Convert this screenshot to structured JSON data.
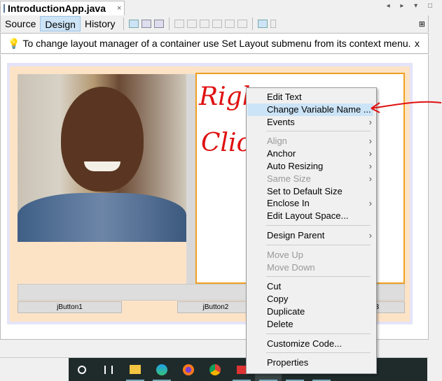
{
  "file_tab": {
    "title": "IntroductionApp.java",
    "close": "×"
  },
  "window_controls": "◂ ▸ ▾ □",
  "view_tabs": [
    {
      "label": "Source"
    },
    {
      "label": "Design",
      "selected": true
    },
    {
      "label": "History"
    }
  ],
  "hint": {
    "text": "To change layout manager of a container use Set Layout submenu from its context menu.",
    "close": "x",
    "icon": "lightbulb-icon"
  },
  "annotation": {
    "line1": "Right",
    "line2": "Click",
    "color": "#e01010"
  },
  "buttons": [
    "jButton1",
    "jButton2",
    "3"
  ],
  "context_menu": {
    "items": [
      {
        "label": "Edit Text"
      },
      {
        "label": "Change Variable Name ...",
        "highlighted": true
      },
      {
        "label": "Events",
        "submenu": true
      },
      {
        "sep": true
      },
      {
        "label": "Align",
        "submenu": true,
        "disabled": true
      },
      {
        "label": "Anchor",
        "submenu": true
      },
      {
        "label": "Auto Resizing",
        "submenu": true
      },
      {
        "label": "Same Size",
        "submenu": true,
        "disabled": true
      },
      {
        "label": "Set to Default Size"
      },
      {
        "label": "Enclose In",
        "submenu": true
      },
      {
        "label": "Edit Layout Space..."
      },
      {
        "sep": true
      },
      {
        "label": "Design Parent",
        "submenu": true
      },
      {
        "sep": true
      },
      {
        "label": "Move Up",
        "disabled": true
      },
      {
        "label": "Move Down",
        "disabled": true
      },
      {
        "sep": true
      },
      {
        "label": "Cut"
      },
      {
        "label": "Copy"
      },
      {
        "label": "Duplicate"
      },
      {
        "label": "Delete"
      },
      {
        "sep": true
      },
      {
        "label": "Customize Code..."
      },
      {
        "sep": true
      },
      {
        "label": "Properties"
      }
    ]
  },
  "taskbar": [
    "search-circle-icon",
    "task-view-icon",
    "file-explorer-icon",
    "edge-icon",
    "firefox-icon",
    "chrome-icon",
    "app-icon",
    "app-icon",
    "app-icon",
    "app-icon"
  ],
  "colors": {
    "highlight": "#cce4f7",
    "selection_border": "#f0a020",
    "panel": "#fde3c6"
  }
}
